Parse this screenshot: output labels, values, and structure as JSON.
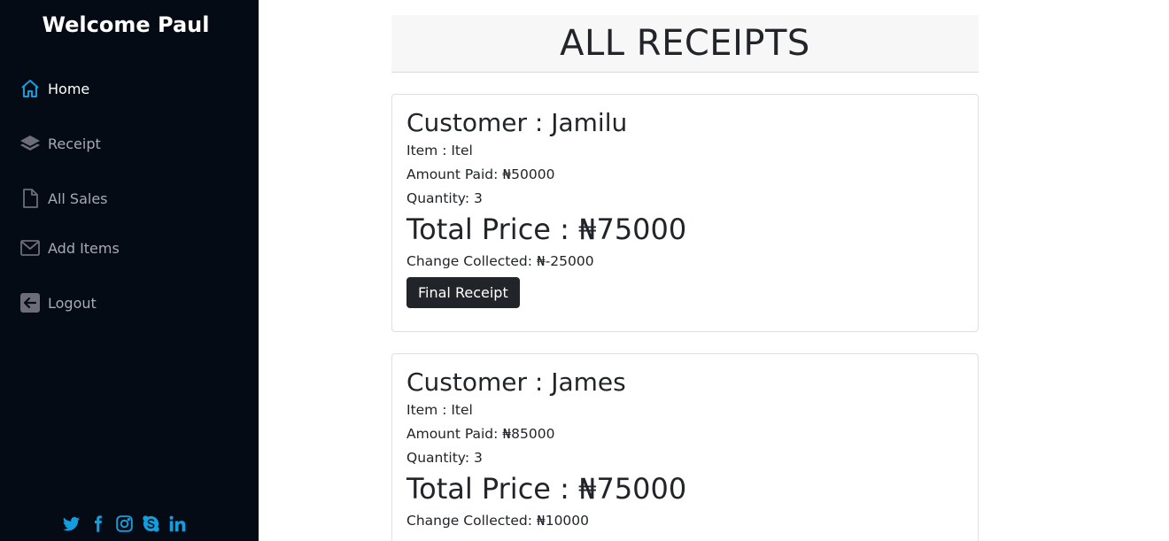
{
  "sidebar": {
    "welcome": "Welcome Paul",
    "items": [
      {
        "label": "Home",
        "icon": "home-icon"
      },
      {
        "label": "Receipt",
        "icon": "layers-icon"
      },
      {
        "label": "All Sales",
        "icon": "file-icon"
      },
      {
        "label": "Add Items",
        "icon": "envelope-icon"
      },
      {
        "label": "Logout",
        "icon": "arrow-left-square-icon"
      }
    ],
    "socials": [
      "twitter-icon",
      "facebook-icon",
      "instagram-icon",
      "skype-icon",
      "linkedin-icon"
    ],
    "accent": "#149ddd",
    "background": "#040b14"
  },
  "main": {
    "title": "ALL RECEIPTS",
    "receipts": [
      {
        "customer": "Customer : Jamilu",
        "item": "Item : Itel",
        "amount_paid": "Amount Paid: ₦50000",
        "quantity": "Quantity: 3",
        "total": "Total Price : ₦75000",
        "change": "Change Collected: ₦-25000",
        "button": "Final Receipt"
      },
      {
        "customer": "Customer : James",
        "item": "Item : Itel",
        "amount_paid": "Amount Paid: ₦85000",
        "quantity": "Quantity: 3",
        "total": "Total Price : ₦75000",
        "change": "Change Collected: ₦10000"
      }
    ]
  }
}
